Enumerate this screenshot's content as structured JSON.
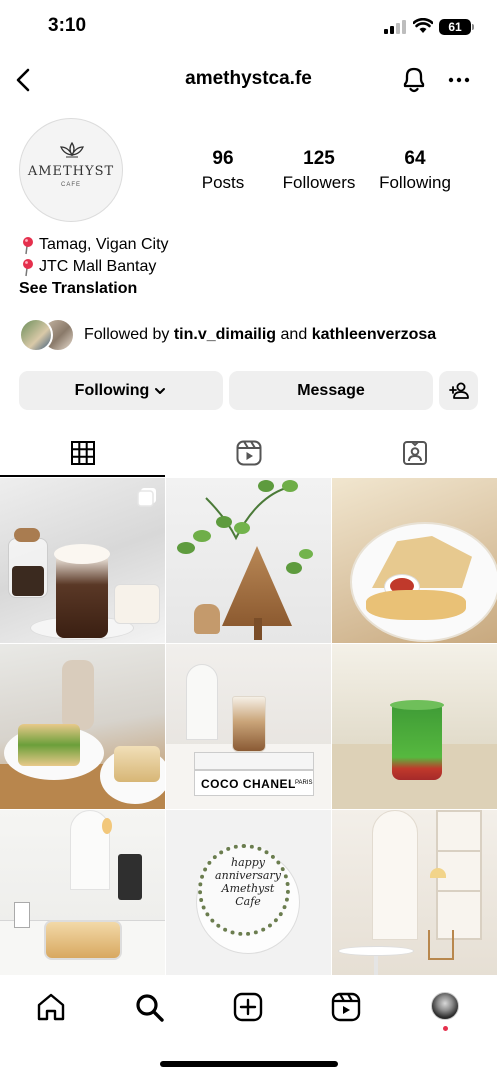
{
  "status_bar": {
    "time": "3:10",
    "battery": "61"
  },
  "header": {
    "username": "amethystca.fe"
  },
  "profile": {
    "avatar_brand": "AMETHYST",
    "avatar_sub": "CAFE",
    "stats": [
      {
        "value": "96",
        "label": "Posts"
      },
      {
        "value": "125",
        "label": "Followers"
      },
      {
        "value": "64",
        "label": "Following"
      }
    ],
    "bio_lines": [
      "Tamag, Vigan City",
      "JTC Mall Bantay"
    ],
    "see_translation": "See Translation",
    "followed_by_prefix": "Followed by",
    "followed_by_user1": "tin.v_dimailig",
    "followed_by_and": "and",
    "followed_by_user2": "kathleenverzosa"
  },
  "actions": {
    "following": "Following",
    "message": "Message"
  },
  "tabs": [
    "grid-icon",
    "reels-icon",
    "tagged-icon"
  ],
  "posts": [
    {
      "label": "Drinks",
      "overlay": "multi-photo-icon"
    },
    {
      "label": "Tree decor"
    },
    {
      "label": "Quesadilla"
    },
    {
      "label": "Sandwich"
    },
    {
      "label": "Latte",
      "book_text": "COCO CHANEL",
      "book_sub": "PARIS"
    },
    {
      "label": "Green drink"
    },
    {
      "label": "Counter"
    },
    {
      "label": "Cake",
      "cake_text_1": "happy",
      "cake_text_2": "anniversary",
      "cake_text_3": "Amethyst",
      "cake_text_4": "Cafe"
    },
    {
      "label": "Interior"
    }
  ],
  "bottom_nav": [
    "home-icon",
    "search-icon",
    "create-icon",
    "reels-icon",
    "profile-avatar"
  ],
  "colors": {
    "accent_red": "#e5304d",
    "button_bg": "#efefef"
  }
}
